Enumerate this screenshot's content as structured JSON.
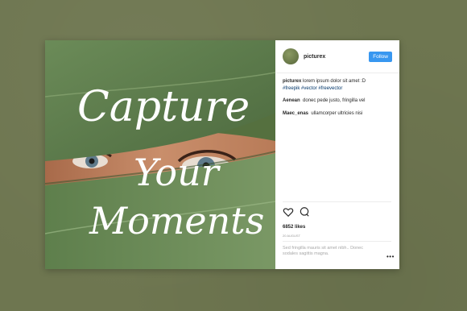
{
  "post": {
    "username": "picturex",
    "follow_label": "Follow",
    "overlay_text": [
      "Capture",
      "Your",
      "Moments"
    ],
    "caption": {
      "user": "picturex",
      "text": "lorem ipsum dolor sit amet :D",
      "hashtags": "#freepik #vector #freevector"
    },
    "comments": [
      {
        "user": "Aenean",
        "text": "donec pede justo, fringilla vel"
      },
      {
        "user": "Maec_enas",
        "text": "ullamcorper ultricies nisi"
      }
    ],
    "likes": "6852 likes",
    "time_ago": "20 AUGUST",
    "add_comment_placeholder": "Sed fringilla mauris sit amet nibh.. Donec sodales sagittis magna.",
    "more_label": "•••"
  },
  "icons": {
    "like": "heart-icon",
    "comment": "comment-icon",
    "options": "more-options-icon"
  },
  "colors": {
    "background": "#6e7650",
    "follow_button": "#3897f0",
    "leaf": "#6a8a58"
  }
}
